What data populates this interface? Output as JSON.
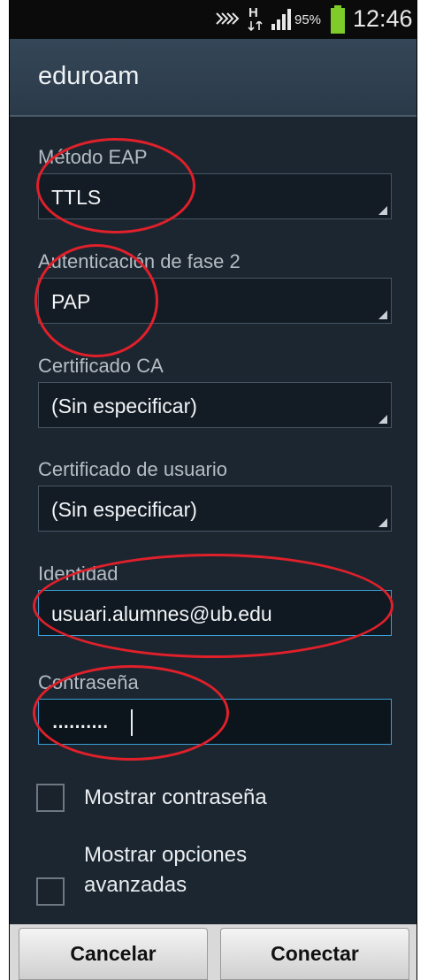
{
  "status_bar": {
    "battery_percent": "95%",
    "time": "12:46",
    "network_type": "H",
    "icons": [
      "missed-notification-icon",
      "hspa-data-icon",
      "signal-icon",
      "battery-icon"
    ]
  },
  "dialog": {
    "title": "eduroam",
    "fields": {
      "eap_method": {
        "label": "Método EAP",
        "value": "TTLS"
      },
      "phase2_auth": {
        "label": "Autenticación de fase 2",
        "value": "PAP"
      },
      "ca_certificate": {
        "label": "Certificado CA",
        "value": "(Sin especificar)"
      },
      "user_certificate": {
        "label": "Certificado de usuario",
        "value": "(Sin especificar)"
      },
      "identity": {
        "label": "Identidad",
        "value": "usuari.alumnes@ub.edu"
      },
      "password": {
        "label": "Contraseña",
        "value": ".........."
      }
    },
    "checkboxes": {
      "show_password": {
        "label": "Mostrar contraseña",
        "checked": false
      },
      "show_advanced_line1": "Mostrar opciones",
      "show_advanced_line2": "avanzadas"
    },
    "buttons": {
      "cancel": "Cancelar",
      "connect": "Conectar"
    }
  },
  "colors": {
    "background": "#1c2630",
    "accent_focus": "#3aa0d6",
    "annotation": "#e0202a",
    "battery": "#7ecb2a"
  }
}
